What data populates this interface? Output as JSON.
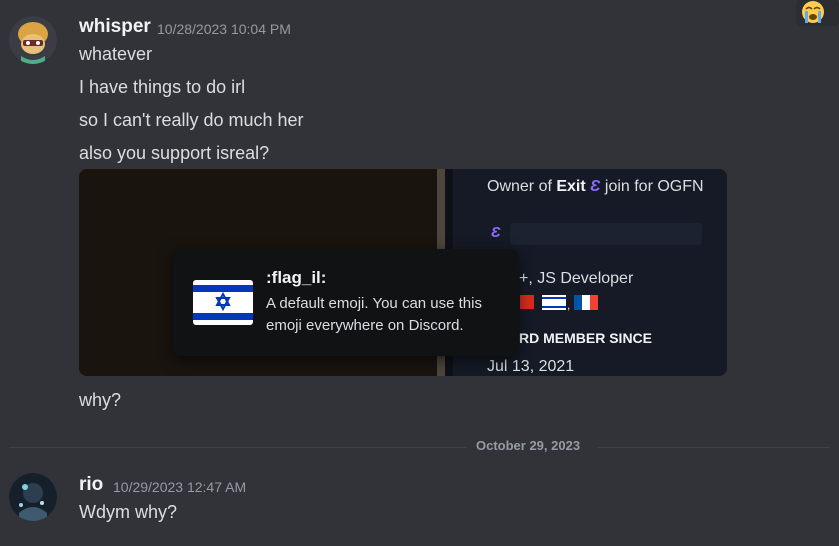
{
  "messages": [
    {
      "username": "whisper",
      "timestamp": "10/28/2023 10:04 PM",
      "lines": [
        "whatever",
        "I have things to do irl",
        "so I can't really do much her",
        "also you support isreal?"
      ],
      "after_embed": "why?"
    },
    {
      "username": "rio",
      "timestamp": "10/29/2023 12:47 AM",
      "lines": [
        "Wdym why?"
      ]
    }
  ],
  "embed": {
    "owner_prefix": "Owner of ",
    "owner_name": "Exit",
    "owner_suffix": " join for OGFN",
    "dev_line": "+, JS Developer",
    "member_since_label": "RD MEMBER SINCE",
    "member_since_date": "Jul 13, 2021"
  },
  "tooltip": {
    "emoji_name": ":flag_il:",
    "description": "A default emoji. You can use this emoji everywhere on Discord."
  },
  "date_divider": "October 29, 2023",
  "icons": {
    "reaction": "loudly-crying-face-icon",
    "flag": "israel-flag-icon",
    "exit_logo": "exit-e-icon"
  }
}
